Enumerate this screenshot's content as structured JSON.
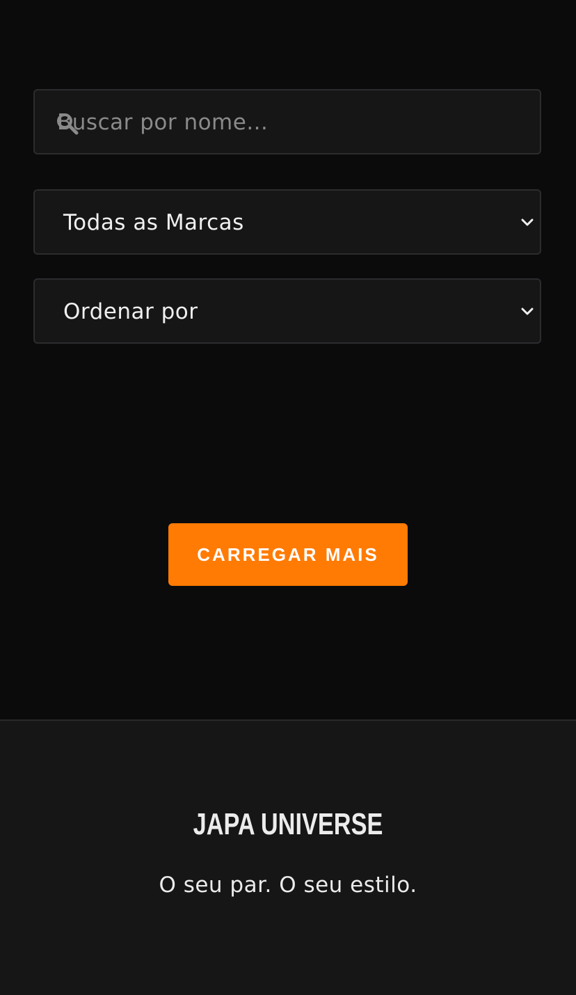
{
  "filters": {
    "search": {
      "placeholder": "Buscar por nome...",
      "icon": "search-icon"
    },
    "brand_select": {
      "selected": "Todas as Marcas",
      "icon": "chevron-down-icon"
    },
    "sort_select": {
      "selected": "Ordenar por",
      "icon": "chevron-down-icon"
    }
  },
  "actions": {
    "load_more_label": "CARREGAR MAIS"
  },
  "footer": {
    "brand": "JAPA UNIVERSE",
    "tagline": "O seu par. O seu estilo."
  },
  "colors": {
    "background": "#0b0b0c",
    "field_background": "#161617",
    "field_border": "#2c2c2e",
    "accent": "#ff7b03",
    "footer_background": "#161616",
    "text": "#ececec",
    "placeholder": "#8a8a8a"
  }
}
